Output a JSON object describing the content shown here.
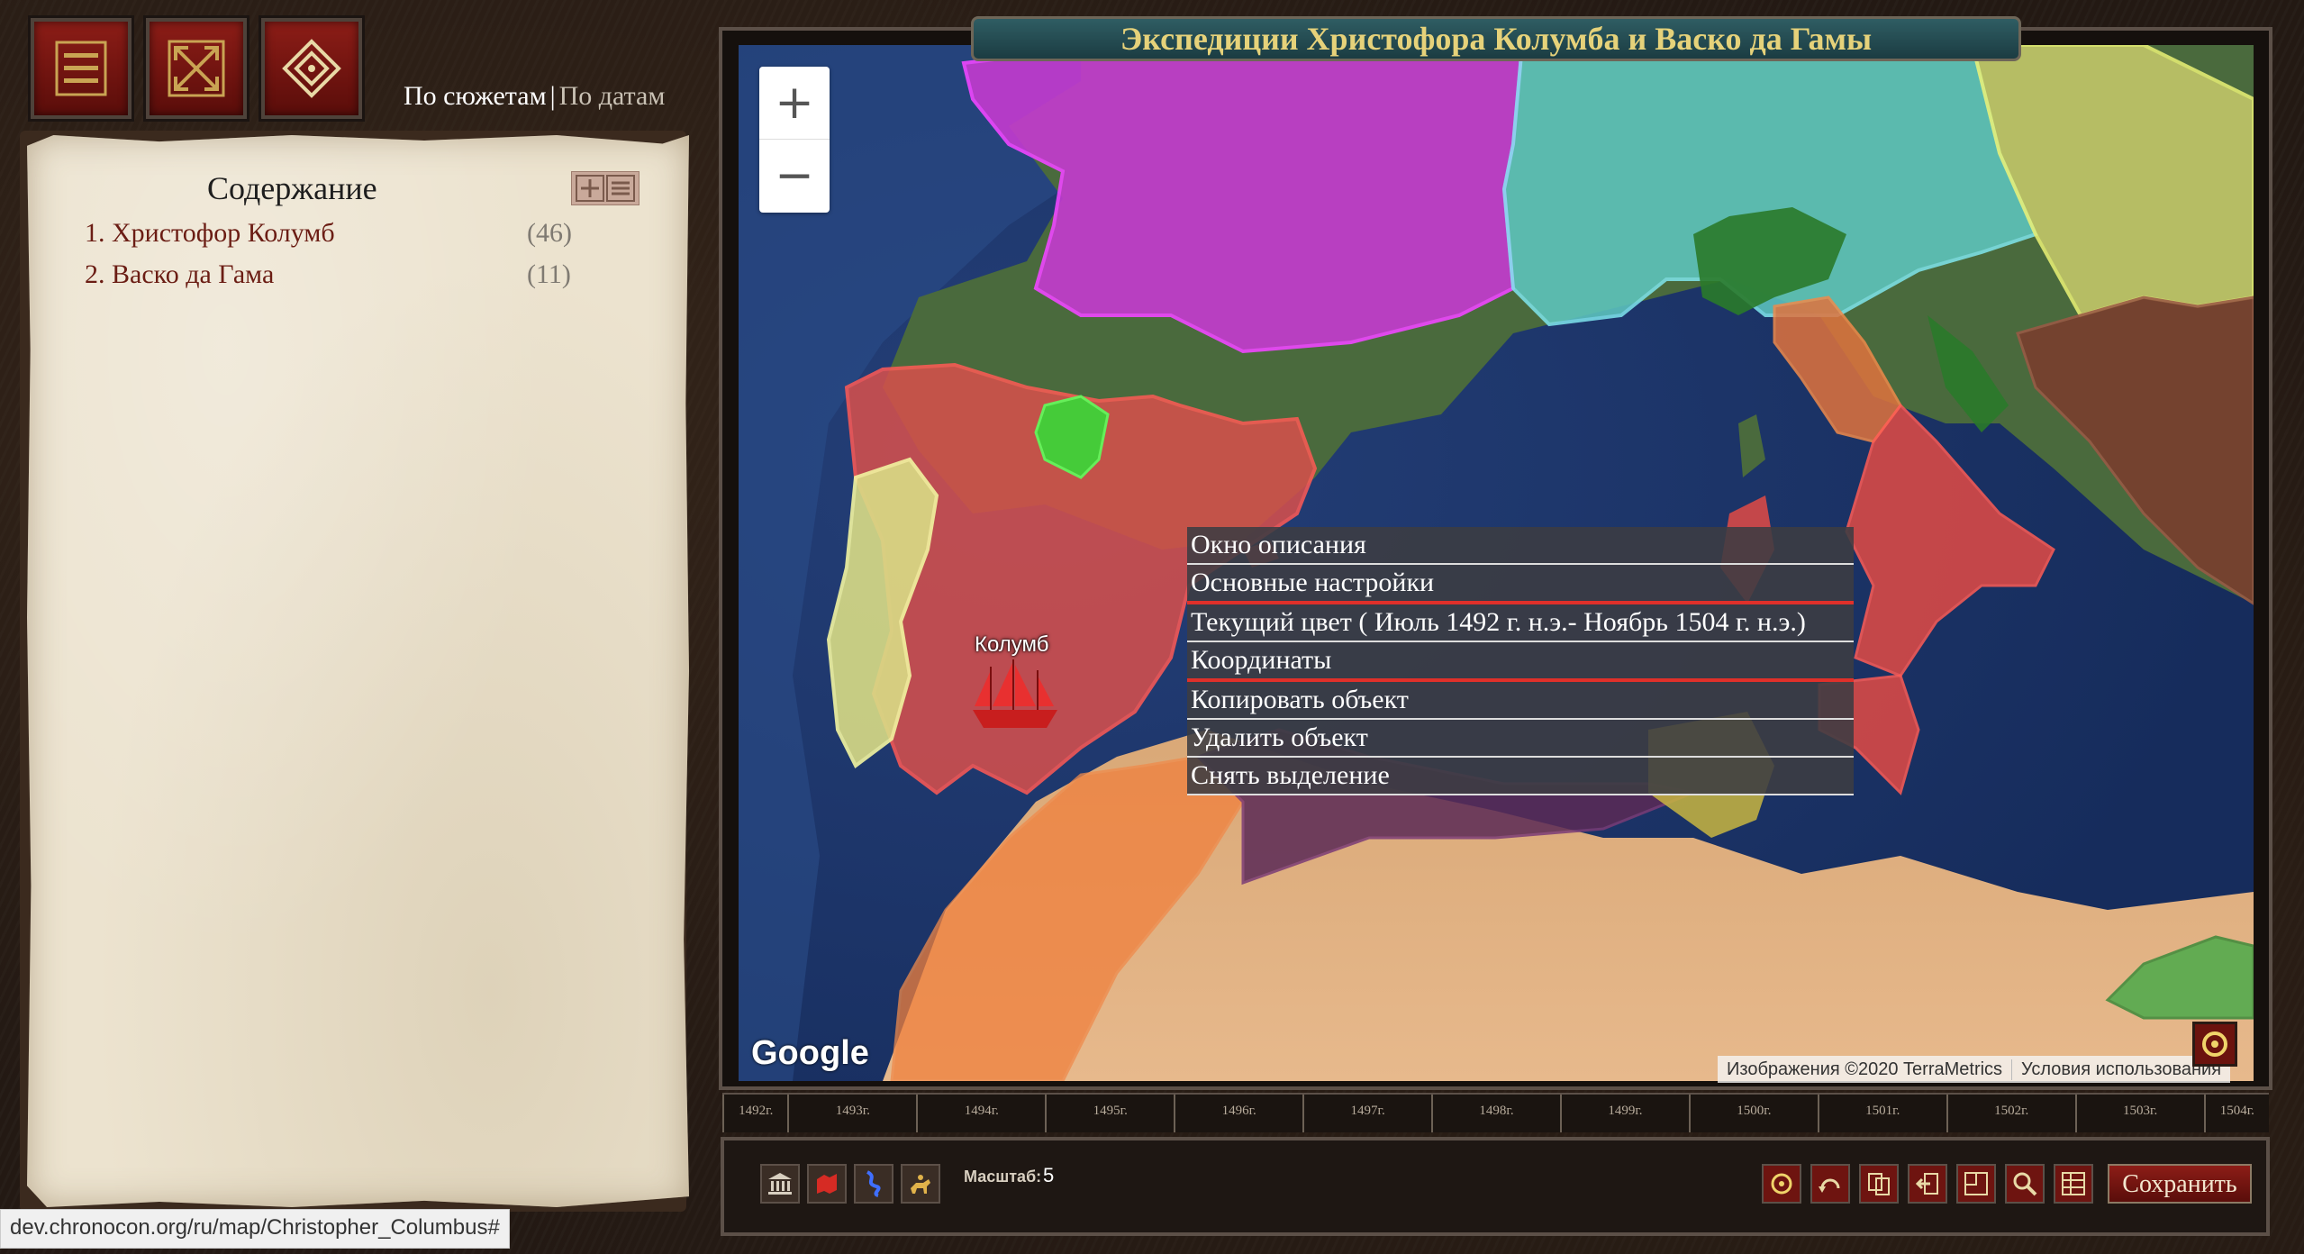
{
  "header": {
    "map_title": "Экспедиции Христофора Колумба и Васко да Гамы",
    "tab_by_plots": "По сюжетам",
    "tab_separator": "|",
    "tab_by_dates": "По датам"
  },
  "top_buttons": [
    {
      "name": "menu-icon"
    },
    {
      "name": "fullscreen-icon"
    },
    {
      "name": "diamond-icon"
    }
  ],
  "toc": {
    "title": "Содержание",
    "items": [
      {
        "label": "1. Христофор Колумб",
        "count": "(46)"
      },
      {
        "label": "2. Васко да Гама",
        "count": "(11)"
      }
    ]
  },
  "map": {
    "zoom_in": "+",
    "zoom_out": "−",
    "google_logo": "Google",
    "attribution_imagery": "Изображения ©2020 TerraMetrics",
    "attribution_terms": "Условия использования",
    "marker_label": "Колумб",
    "colors": {
      "france": "#c43bd0",
      "spain": "#d9504c",
      "portugal": "#d9dc86",
      "navarre": "#38d838",
      "holy_roman_empire": "#5fc9c2",
      "hungary": "#c5c96a",
      "italy_south": "#e24b45",
      "papal_states": "#e0733e",
      "north_africa": "#f0803d",
      "ottoman": "#7a3d2e",
      "sea": "#1f3a70"
    }
  },
  "context_menu": [
    {
      "label": "Окно описания"
    },
    {
      "label": "Основные настройки"
    },
    {
      "label": "Текущий цвет ( Июль 1492 г. н.э.- Ноябрь 1504 г. н.э.)"
    },
    {
      "label": "Координаты"
    },
    {
      "label": "Копировать объект"
    },
    {
      "label": "Удалить объект"
    },
    {
      "label": "Снять выделение"
    }
  ],
  "timeline": [
    "1492г.",
    "1493г.",
    "1494г.",
    "1495г.",
    "1496г.",
    "1497г.",
    "1498г.",
    "1499г.",
    "1500г.",
    "1501г.",
    "1502г.",
    "1503г.",
    "1504г."
  ],
  "toolbar": {
    "scale_label": "Масштаб:",
    "scale_value": "5",
    "save_label": "Сохранить",
    "left_tools": [
      "museum-icon",
      "map-icon",
      "river-icon",
      "rider-icon"
    ],
    "right_tools": [
      "target-icon",
      "undo-icon",
      "copy-icon",
      "exit-icon",
      "layout-icon",
      "search-icon",
      "grid-icon"
    ]
  },
  "status_url": "dev.chronocon.org/ru/map/Christopher_Columbus#"
}
